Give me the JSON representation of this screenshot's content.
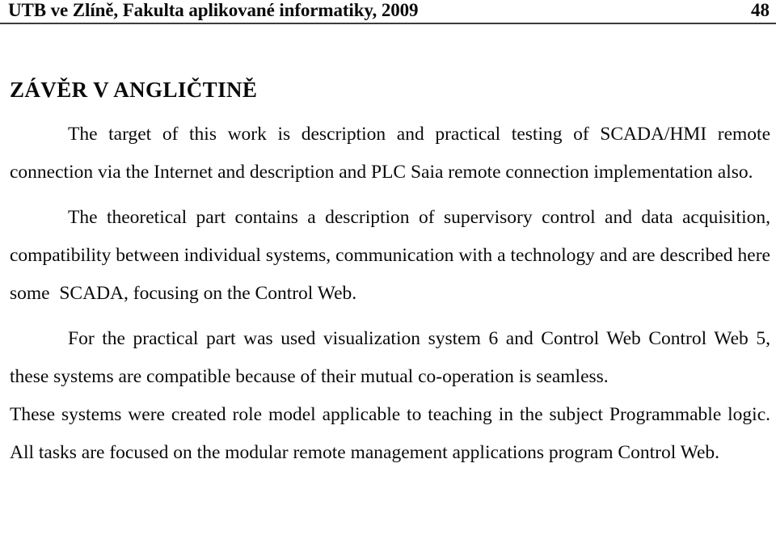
{
  "document": {
    "header": {
      "title": "UTB ve Zlíně, Fakulta aplikované informatiky, 2009",
      "page_number": "48"
    },
    "section_heading": "ZÁVĚR V ANGLIČTINĚ",
    "paragraphs": [
      {
        "id": "p1",
        "indent": true,
        "text": "The target of this work is description and practical testing of SCADA/HMI remote connection via the Internet and description and PLC Saia remote connection implementation also."
      },
      {
        "id": "p2",
        "indent": true,
        "text": "The theoretical part contains a description of supervisory control and data acquisition, compatibility between individual systems, communication with a technology and are described here some  SCADA, focusing on the Control Web."
      },
      {
        "id": "p3",
        "indent": true,
        "text": "For the practical part was used visualization system 6 and Control Web Control Web 5, these systems are compatible because of their mutual co-operation is seamless."
      },
      {
        "id": "p4",
        "indent": false,
        "text": "These systems were created role model applicable to teaching in the subject Programmable logic. All tasks are focused on the modular remote management applications program Control Web."
      }
    ]
  },
  "colors": {
    "text": "#0a0a0a",
    "rule": "#3d3d3d",
    "background": "#ffffff"
  }
}
